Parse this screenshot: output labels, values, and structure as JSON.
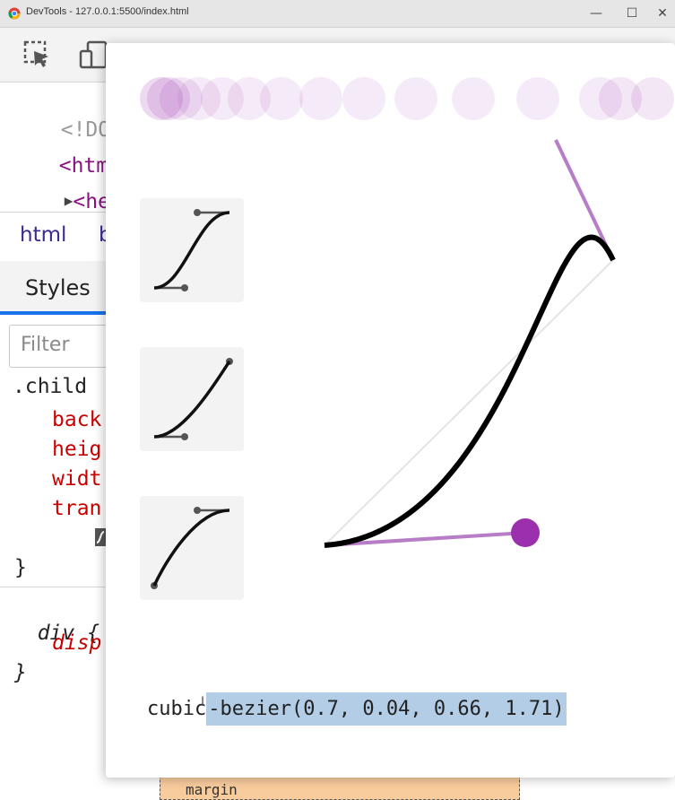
{
  "window": {
    "title": "DevTools - 127.0.0.1:5500/index.html",
    "minimize": "—",
    "maximize": "☐",
    "close": "✕"
  },
  "toolbar": {
    "icons": [
      "inspect-element-icon",
      "device-toolbar-icon"
    ]
  },
  "elements": {
    "lines": [
      {
        "bracket_open": "<",
        "text": "!DOCT",
        "kind": "doctype"
      },
      {
        "bracket_open": "<",
        "text": "html",
        "kind": "tag"
      },
      {
        "arrow": "▶",
        "bracket_open": "<",
        "text": "hea",
        "kind": "tag"
      }
    ]
  },
  "breadcrumbs": [
    "html",
    "b"
  ],
  "panel_tabs": {
    "styles": "Styles"
  },
  "filter": {
    "placeholder": "Filter"
  },
  "rules": {
    "child_selector": ".child",
    "child_props": [
      "back",
      "heig",
      "widt",
      "tran"
    ],
    "close_brace": "}",
    "div_selector": "div",
    "div_open": "{",
    "div_props": [
      "disp"
    ],
    "div_close": "}"
  },
  "box_model": {
    "margin_label": "margin"
  },
  "bezier_editor": {
    "value_prefix": "cubic",
    "value_highlighted": "-bezier(0.7, 0.04, 0.66, 1.71)",
    "control_points": [
      0.7,
      0.04,
      0.66,
      1.71
    ],
    "accent_color": "#9b2fae",
    "presets": [
      "ease-in-out-preset",
      "ease-in-preset",
      "ease-out-preset"
    ]
  }
}
